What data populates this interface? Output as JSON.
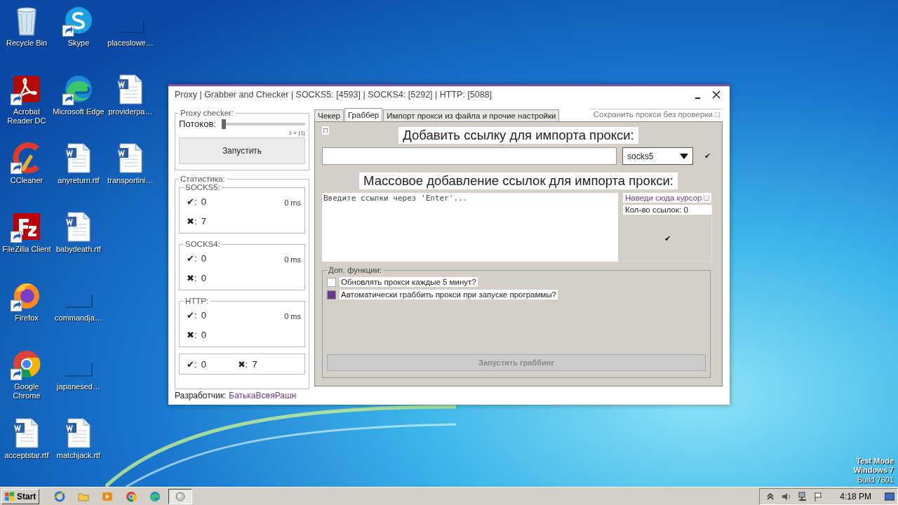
{
  "desktop_icons": [
    {
      "label": "Recycle Bin",
      "kind": "recycle",
      "shortcut": false
    },
    {
      "label": "Acrobat Reader DC",
      "kind": "acrobat",
      "shortcut": true
    },
    {
      "label": "CCleaner",
      "kind": "ccleaner",
      "shortcut": true
    },
    {
      "label": "FileZilla Client",
      "kind": "filezilla",
      "shortcut": true
    },
    {
      "label": "Firefox",
      "kind": "firefox",
      "shortcut": true
    },
    {
      "label": "Google Chrome",
      "kind": "chrome",
      "shortcut": true
    },
    {
      "label": "acceptstar.rtf",
      "kind": "word",
      "shortcut": false
    },
    {
      "label": "Skype",
      "kind": "skype",
      "shortcut": true
    },
    {
      "label": "Microsoft Edge",
      "kind": "edge",
      "shortcut": true
    },
    {
      "label": "anyreturn.rtf",
      "kind": "word",
      "shortcut": false
    },
    {
      "label": "babydeath.rtf",
      "kind": "word",
      "shortcut": false
    },
    {
      "label": "commandja…",
      "kind": "blank",
      "shortcut": false
    },
    {
      "label": "japanesed…",
      "kind": "blank",
      "shortcut": false
    },
    {
      "label": "matchjack.rtf",
      "kind": "word",
      "shortcut": false
    },
    {
      "label": "placeslowe…",
      "kind": "blank",
      "shortcut": false
    },
    {
      "label": "providerpa…",
      "kind": "word",
      "shortcut": false
    },
    {
      "label": "transportini…",
      "kind": "word",
      "shortcut": false
    }
  ],
  "window": {
    "title": "Proxy | Grabber and Checker | SOCKS5: [4593] | SOCKS4: [5292] | HTTP: [5088]",
    "checker": {
      "title": "Proxy checker:",
      "threads_label": "Потоков:",
      "threads": {
        "level": 0
      },
      "threads_reading": "1 × {1}",
      "start_button": "Запустить"
    },
    "stats": {
      "title": "Статистика:",
      "groups": [
        {
          "name": "SOCKS5:",
          "time": "0 ms",
          "rows": [
            {
              "mark": "✔:",
              "value": "0"
            },
            {
              "mark": "✖:",
              "value": "7"
            }
          ]
        },
        {
          "name": "SOCKS4:",
          "time": "0 ms",
          "rows": [
            {
              "mark": "✔:",
              "value": "0"
            },
            {
              "mark": "✖:",
              "value": "0"
            }
          ]
        },
        {
          "name": "HTTP:",
          "time": "0 ms",
          "rows": [
            {
              "mark": "✔:",
              "value": "0"
            },
            {
              "mark": "✖:",
              "value": "0"
            }
          ]
        }
      ],
      "total": [
        {
          "mark": "✔:",
          "value": "0"
        },
        {
          "mark": "✖:",
          "value": "7"
        }
      ]
    },
    "developer": {
      "label": "Разработчик:",
      "name": "БатькаВсеяРашн"
    },
    "tabs": [
      {
        "label": "Чекер",
        "selected": false
      },
      {
        "label": "Граббер",
        "selected": true
      },
      {
        "label": "Импорт прокси из файла и прочие настройки",
        "selected": false
      }
    ],
    "save_without_check": "Сохранить прокси без проверки □",
    "grabber": {
      "corner_box": "□",
      "add_heading": "Добавить ссылку для импорта прокси:",
      "protocol_select": {
        "value": "socks5"
      },
      "confirm_mark": "✔",
      "bulk_heading": "Массовое добавление ссылок для импорта прокси:",
      "links_field": {
        "placeholder": "Введите ссылки через 'Enter'..."
      },
      "hover_hint": "Наведи сюда курсор □",
      "link_count": "Кол-во ссылок: 0",
      "bulk_confirm": "✔",
      "extras": {
        "title": "Доп. функции:",
        "options": [
          {
            "label": "Обновлять прокси каждые 5 минут?",
            "checked": false
          },
          {
            "label": "Автоматически граббить прокси при запуске программы?",
            "checked": true
          }
        ]
      },
      "grab_button": {
        "label": "Запустить граббинг",
        "disabled": true
      }
    }
  },
  "os_notice": [
    "Test Mode",
    "Windows 7",
    "Build 7601"
  ],
  "taskbar": {
    "start": "Start",
    "apps": [
      {
        "kind": "ie",
        "selected": false
      },
      {
        "kind": "explorer",
        "selected": false
      },
      {
        "kind": "media",
        "selected": false
      },
      {
        "kind": "chrome",
        "selected": false
      },
      {
        "kind": "edge",
        "selected": false
      },
      {
        "kind": "window",
        "selected": true
      }
    ],
    "time": "4:18 PM"
  }
}
